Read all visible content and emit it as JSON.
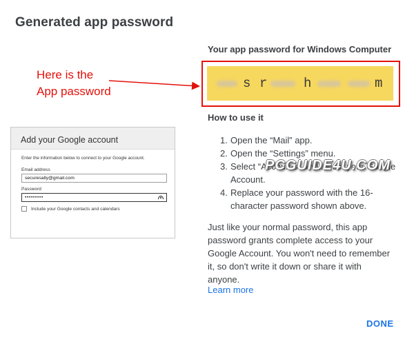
{
  "dialog": {
    "title": "Generated app password",
    "annotation_line1": "Here is the",
    "annotation_line2": "App password",
    "annotation_color": "#e3110b"
  },
  "mail_dialog": {
    "title": "Add your Google account",
    "intro": "Enter the information below to connect to your Google account.",
    "email_label": "Email address",
    "email_value": "securesally@gmail.com",
    "password_label": "Password",
    "password_value": "•••••••••",
    "checkbox_label": "Include your Google contacts and calendars"
  },
  "password": {
    "heading": "Your app password for Windows Computer",
    "visible_chars": [
      "s",
      "r",
      "h",
      "m"
    ],
    "box_color": "#f7d85e"
  },
  "howto": {
    "heading": "How to use it",
    "steps": [
      {
        "num": "1.",
        "text": "Open the “Mail” app."
      },
      {
        "num": "2.",
        "text": "Open the “Settings” menu."
      },
      {
        "num": "3.",
        "text": "Select “Accounts” and select your Google Account."
      },
      {
        "num": "4.",
        "text": "Replace your password with the 16-character password shown above."
      }
    ]
  },
  "watermark": "PCGUIDE4U.COM",
  "info": {
    "paragraph": "Just like your normal password, this app password grants complete access to your Google Account. You won't need to remember it, so don't write it down or share it with anyone.",
    "learn_more": "Learn more"
  },
  "actions": {
    "done": "DONE",
    "accent": "#1a73e8"
  }
}
